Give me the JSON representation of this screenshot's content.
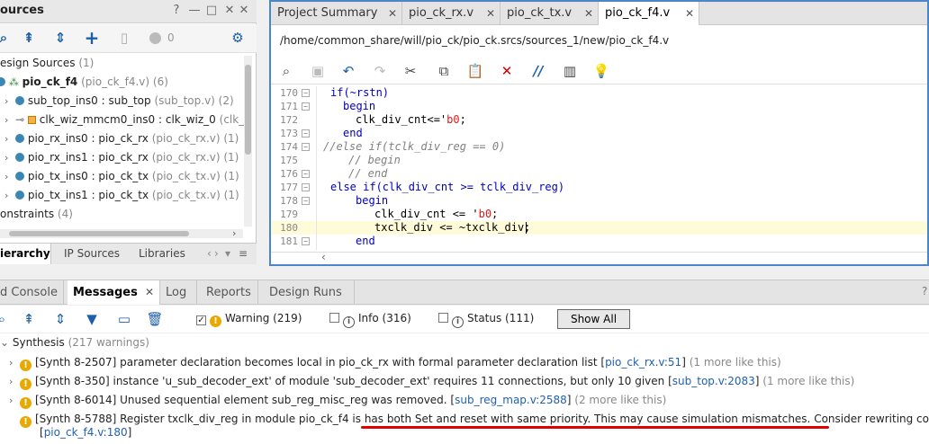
{
  "sources": {
    "title": "ources",
    "header_buttons": [
      "?",
      "—",
      "□",
      "✕"
    ],
    "toolbar_count": "0",
    "tree": [
      {
        "label": "esign Sources",
        "detail": "(1)"
      },
      {
        "label": "pio_ck_f4",
        "detail": "(pio_ck_f4.v) (6)"
      },
      {
        "label": "sub_top_ins0 : sub_top",
        "detail": "(sub_top.v) (2)"
      },
      {
        "label": "clk_wiz_mmcm0_ins0 : clk_wiz_0",
        "detail": "(clk_"
      },
      {
        "label": "pio_rx_ins0 : pio_ck_rx",
        "detail": "(pio_ck_rx.v) (1)"
      },
      {
        "label": "pio_rx_ins1 : pio_ck_rx",
        "detail": "(pio_ck_rx.v) (1)"
      },
      {
        "label": "pio_tx_ins0 : pio_ck_tx",
        "detail": "(pio_ck_tx.v) (1)"
      },
      {
        "label": "pio_tx_ins1 : pio_ck_tx",
        "detail": "(pio_ck_tx.v) (1)"
      },
      {
        "label": "onstraints",
        "detail": "(4)"
      }
    ],
    "tabs": [
      "ierarchy",
      "IP Sources",
      "Libraries"
    ]
  },
  "editor": {
    "tabs": [
      "Project Summary",
      "pio_ck_rx.v",
      "pio_ck_tx.v",
      "pio_ck_f4.v"
    ],
    "path": "/home/common_share/will/pio_ck/pio_ck.srcs/sources_1/new/pio_ck_f4.v",
    "lines": [
      {
        "n": "170",
        "pre": "if(~rstn)",
        "num": "",
        "post": ""
      },
      {
        "n": "171",
        "pre": "begin",
        "num": "",
        "post": ""
      },
      {
        "n": "172",
        "pre": "clk_div_cnt<='",
        "num": "b0",
        "post": ";"
      },
      {
        "n": "173",
        "pre": "end",
        "num": "",
        "post": ""
      },
      {
        "n": "174",
        "pre": "//else if(tclk_div_reg == 0)",
        "num": "",
        "post": ""
      },
      {
        "n": "175",
        "pre": "// begin",
        "num": "",
        "post": ""
      },
      {
        "n": "176",
        "pre": "// end",
        "num": "",
        "post": ""
      },
      {
        "n": "177",
        "pre": "else if(clk_div_cnt >= tclk_div_reg)",
        "num": "",
        "post": ""
      },
      {
        "n": "178",
        "pre": "begin",
        "num": "",
        "post": ""
      },
      {
        "n": "179",
        "pre": "clk_div_cnt <= '",
        "num": "b0",
        "post": ";"
      },
      {
        "n": "180",
        "pre": "txclk_div <= ~txclk_div;",
        "num": "",
        "post": ""
      },
      {
        "n": "181",
        "pre": "end",
        "num": "",
        "post": ""
      }
    ]
  },
  "messages": {
    "tabs": [
      "d Console",
      "Messages",
      "Log",
      "Reports",
      "Design Runs"
    ],
    "filters": {
      "warning": "Warning (219)",
      "info": "Info (316)",
      "status": "Status (111)"
    },
    "show_all": "Show All",
    "group": {
      "label": "Synthesis",
      "detail": "(217 warnings)"
    },
    "items": [
      {
        "text": "[Synth 8-2507] parameter declaration becomes local in pio_ck_rx with formal parameter declaration list [",
        "link": "pio_ck_rx.v:51",
        "after": "]",
        "more": "(1 more like this)"
      },
      {
        "text": "[Synth 8-350] instance 'u_sub_decoder_ext' of module 'sub_decoder_ext' requires 11 connections, but only 10 given [",
        "link": "sub_top.v:2083",
        "after": "]",
        "more": "(1 more like this)"
      },
      {
        "text": "[Synth 8-6014] Unused sequential element sub_reg_misc_reg was removed. [",
        "link": "sub_reg_map.v:2588",
        "after": "]",
        "more": "(2 more like this)"
      },
      {
        "text": "[Synth 8-5788] Register txclk_div_reg in module pio_ck_f4 is has both Set and reset with same priority. This may cause simulation mismatches. Consider rewriting code",
        "link": "pio_ck_f4.v:180",
        "after": "]",
        "more": ""
      }
    ]
  },
  "colors": {
    "accent": "#4a86c8",
    "warning": "#e8a800",
    "link": "#2060b0",
    "underline": "#e00000"
  }
}
